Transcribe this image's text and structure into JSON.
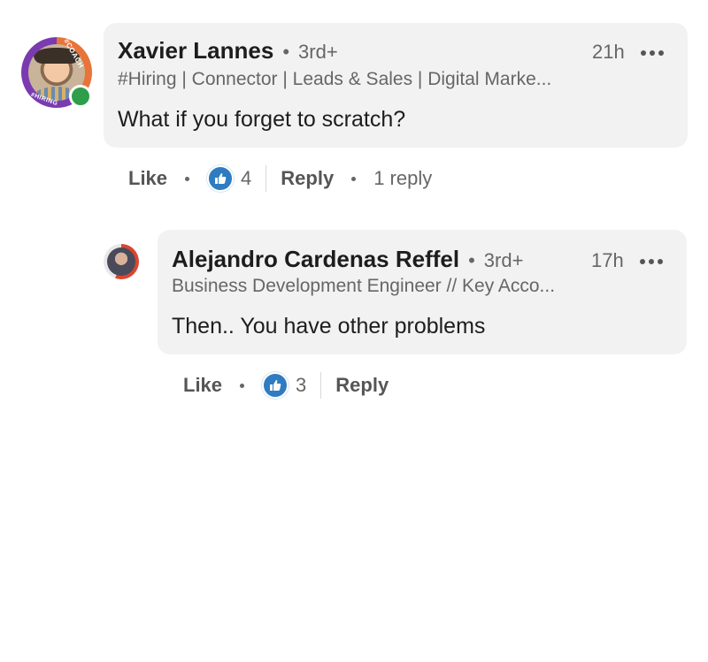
{
  "comments": [
    {
      "author": "Xavier Lannes",
      "degree": "3rd+",
      "time": "21h",
      "headline": "#Hiring | Connector | Leads & Sales | Digital Marke...",
      "text": "What if you forget to scratch?",
      "avatar_ring_top": "#COACH",
      "avatar_ring_bottom": "#HIRING",
      "like_label": "Like",
      "reaction_count": "4",
      "reply_label": "Reply",
      "replies_label": "1 reply"
    },
    {
      "author": "Alejandro Cardenas Reffel",
      "degree": "3rd+",
      "time": "17h",
      "headline": "Business Development Engineer // Key Acco...",
      "text": "Then.. You have other problems",
      "like_label": "Like",
      "reaction_count": "3",
      "reply_label": "Reply"
    }
  ],
  "colors": {
    "bubble": "#f2f2f2",
    "like_blue": "#2f7cc1",
    "online_green": "#2e9e4a",
    "muted_text": "#666666"
  },
  "icons": {
    "more": "more-horizontal-icon",
    "like": "thumbs-up-icon"
  }
}
